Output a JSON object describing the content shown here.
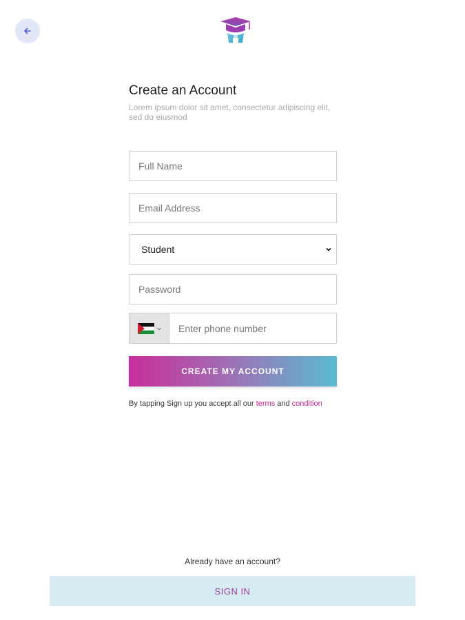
{
  "header": {
    "back_icon": "arrow-left-icon",
    "logo_icon": "graduation-cap-logo"
  },
  "form": {
    "title": "Create an Account",
    "subtitle": "Lorem ipsum dolor sit amet, consectetur adipiscing elit, sed do eiusmod",
    "full_name_placeholder": "Full Name",
    "email_placeholder": "Email Address",
    "role_selected": "Student",
    "password_placeholder": "Password",
    "phone_placeholder": "Enter phone number",
    "country_flag_icon": "palestine-flag-icon",
    "create_button": "CREATE MY ACCOUNT"
  },
  "terms": {
    "prefix": "By tapping Sign up you accept all our ",
    "terms_link": "terms",
    "and": " and ",
    "condition_link": "condition"
  },
  "footer": {
    "already": "Already have an account?",
    "signin_button": "SIGN IN"
  },
  "colors": {
    "accent_pink": "#c72e9b",
    "accent_blue": "#5bbbd3",
    "signin_bg": "#d6ebf2"
  }
}
